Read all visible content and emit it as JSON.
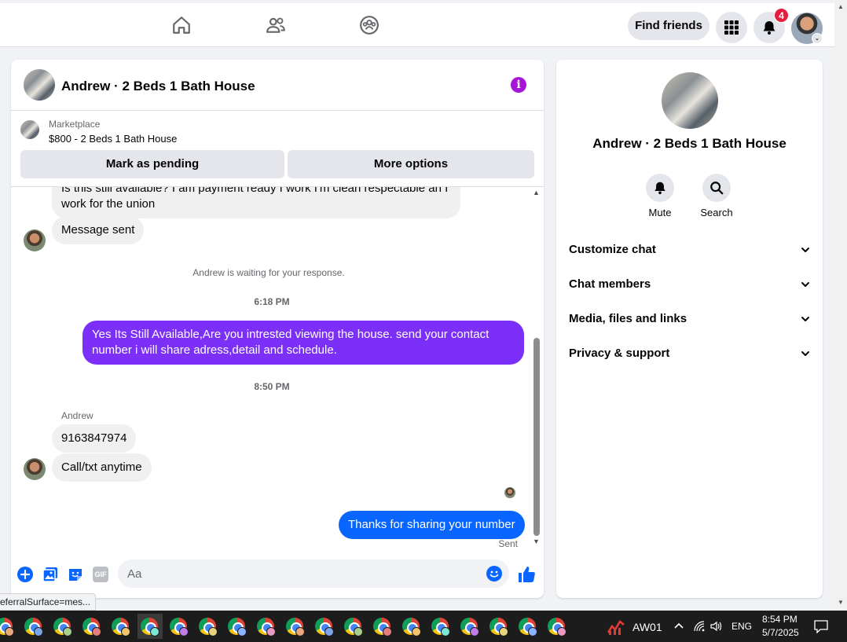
{
  "topnav": {
    "icons": [
      "home-icon",
      "friends-icon",
      "groups-icon"
    ],
    "find_friends_label": "Find friends",
    "menu_icon": "grid-menu-icon",
    "notifications_icon": "bell-icon",
    "notifications_count": "4",
    "profile_caret": "⌄"
  },
  "chat": {
    "title": "Andrew · 2 Beds 1 Bath House",
    "info_icon_glyph": "i",
    "marketplace": {
      "source": "Marketplace",
      "listing": "$800 - 2 Beds 1 Bath House",
      "mark_pending_label": "Mark as pending",
      "more_options_label": "More options"
    },
    "messages": {
      "partial_incoming": "Is this still available? I am payment ready I work I'm clean respectable an I work for the union",
      "message_sent": "Message sent",
      "waiting_notice": "Andrew is waiting for your response.",
      "time_1": "6:18 PM",
      "outgoing_1": "Yes Its Still Available,Are you intrested viewing the house. send your contact number i will share adress,detail and schedule.",
      "time_2": "8:50 PM",
      "sender_name": "Andrew",
      "incoming_phone": "9163847974",
      "incoming_call": "Call/txt anytime",
      "outgoing_2": "Thanks for sharing your number",
      "sent_status": "Sent"
    },
    "composer": {
      "placeholder": "Aa",
      "icons": [
        "plus-circle-icon",
        "photo-icon",
        "sticker-icon",
        "gif-icon",
        "emoji-icon",
        "thumbs-up-icon"
      ],
      "gif_label": "GIF"
    },
    "colors": {
      "outgoing_purple": "#7b2ff7",
      "outgoing_blue": "#0866ff",
      "accent": "#0866ff"
    }
  },
  "details": {
    "title": "Andrew · 2 Beds 1 Bath House",
    "mute_label": "Mute",
    "search_label": "Search",
    "sections": [
      "Customize chat",
      "Chat members",
      "Media, files and links",
      "Privacy & support"
    ]
  },
  "status_url": "eferralSurface=mes...",
  "taskbar": {
    "app_count": 20,
    "tray_app_label": "AW01",
    "language": "ENG",
    "time": "8:54 PM",
    "date": "5/7/2025"
  }
}
